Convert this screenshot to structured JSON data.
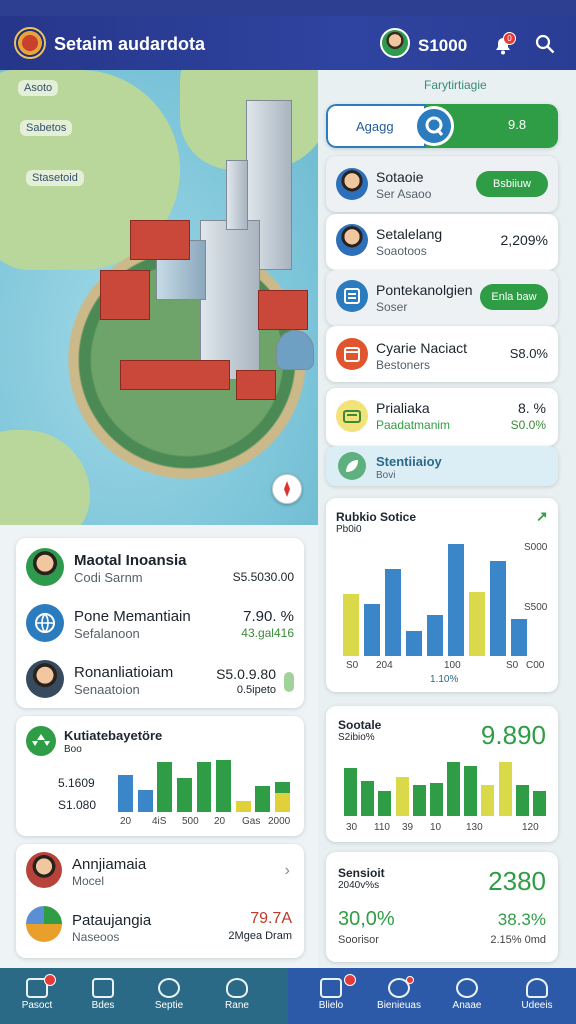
{
  "app": {
    "title": "Setaim audardota",
    "balance": "S1000",
    "notif_count": "0"
  },
  "map": {
    "labels": [
      "Asoto",
      "Sabetos",
      "Stasetoid"
    ]
  },
  "right_panel": {
    "header": "Farytirtiagie",
    "tabs": {
      "left": "Agagg",
      "right": "9.8"
    },
    "items": [
      {
        "name": "Sotaoie",
        "sub": "Ser Asaoo",
        "value": "",
        "action": "Bsbiiuw",
        "icon": "person-avatar"
      },
      {
        "name": "Setalelang",
        "sub": "Soaotoos",
        "value": "2,209%",
        "action": "",
        "icon": "person-avatar"
      },
      {
        "name": "Pontekanolgien",
        "sub": "Soser",
        "value": "",
        "action": "Enla baw",
        "icon": "document-icon"
      },
      {
        "name": "Cyarie Naciact",
        "sub": "Bestoners",
        "value": "S8.0%",
        "action": "",
        "icon": "calendar-icon"
      },
      {
        "name": "Prialiaka",
        "sub": "Paadatmanim",
        "value": "8. %",
        "value2": "S0.0%",
        "icon": "wallet-icon"
      },
      {
        "name": "Stentiiaioy",
        "sub": "Bovi",
        "value": "",
        "icon": "leaf-icon"
      }
    ],
    "chart1": {
      "title": "Rubkio Sotice",
      "subtitle": "Pb0i0",
      "badge": "↗"
    },
    "chart2": {
      "title": "Sootale",
      "subtitle": "S2ibio%",
      "value": "9.890"
    },
    "stat": {
      "title": "Sensioit",
      "subtitle": "2040v%s",
      "value": "2380",
      "pct1": "30,0%",
      "sub1": "Soorisor",
      "pct2": "38.3%",
      "sub2": "2.15% 0md"
    }
  },
  "left_panel": {
    "list": [
      {
        "name": "Maotal Inoansia",
        "sub": "Codi Sarnm",
        "value": "S5.5030.00",
        "value2": ""
      },
      {
        "name": "Pone Memantiain",
        "sub": "Sefalanoon",
        "value": "7.90. %",
        "value2": "43.gal416"
      },
      {
        "name": "Ronanliatioiam",
        "sub": "Senaatoion",
        "value": "S5.0.9.80",
        "value2": "0.5ipeto"
      }
    ],
    "chart": {
      "title": "Kutiatebayetöre",
      "subtitle": "Boo",
      "y1": "5.1609",
      "y2": "S1.080"
    },
    "bottom": [
      {
        "name": "Annjiamaia",
        "sub": "Mocel",
        "value": ""
      },
      {
        "name": "Pataujangia",
        "sub": "Naseoos",
        "value": "79.7A",
        "value2": "2Mgea Dram"
      }
    ]
  },
  "chart_data": [
    {
      "type": "bar",
      "title": "Rubkio Sotice",
      "categories": [
        "S0",
        "204",
        "",
        "100",
        "",
        "S0",
        "",
        "C00"
      ],
      "series": [
        {
          "values": [
            3.0,
            2.5,
            4.2,
            1.2,
            2.0,
            5.4,
            3.1,
            4.6,
            1.8
          ]
        }
      ],
      "ytick_labels": [
        "S000",
        "S500"
      ],
      "xtick_labels": [
        "S0",
        "204",
        "100",
        "S0",
        "C00"
      ],
      "footer": "1.10%"
    },
    {
      "type": "bar",
      "title": "Kutiatebayetöre",
      "categories": [
        "20",
        "4iS",
        "500",
        "20",
        "Gas",
        "2000"
      ],
      "series": [
        {
          "name": "blue",
          "values": [
            2.0,
            1.2,
            0,
            0,
            0,
            0,
            0,
            0
          ]
        },
        {
          "name": "green",
          "values": [
            0,
            0,
            2.7,
            1.8,
            2.7,
            2.8,
            0,
            1.4,
            1.6
          ]
        },
        {
          "name": "yellow",
          "values": [
            0,
            0,
            0,
            0,
            0,
            0,
            0.6,
            0,
            1.0
          ]
        }
      ],
      "xtick_labels": [
        "20",
        "4iS",
        "500",
        "20",
        "Gas",
        "2000"
      ]
    },
    {
      "type": "bar",
      "title": "Sootale",
      "series": [
        {
          "values": [
            2.3,
            1.7,
            1.2,
            1.9,
            1.5,
            1.6,
            2.6,
            2.4,
            1.5,
            2.6,
            1.5,
            1.2
          ]
        }
      ],
      "xtick_labels": [
        "30",
        "110",
        "39",
        "10",
        "130",
        "120"
      ]
    }
  ]
}
